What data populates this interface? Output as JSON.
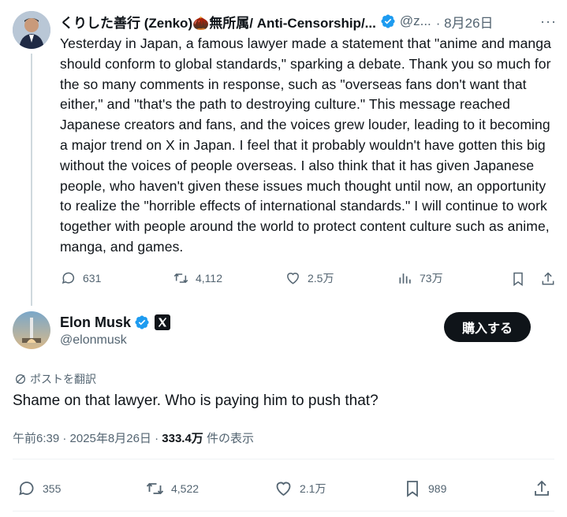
{
  "reply_tweet": {
    "author_name": "くりした善行 (Zenko)🌰無所属/ Anti-Censorship/...",
    "handle": "@z...",
    "timestamp": "· 8月26日",
    "text": "Yesterday in Japan, a famous lawyer made a statement that \"anime and manga should conform to global standards,\" sparking a debate. Thank you so much for the so many comments in response, such as \"overseas fans don't want that either,\" and \"that's the path to destroying culture.\" This message reached Japanese creators and fans, and the voices grew louder, leading to it becoming a major trend on X in Japan. I feel that it probably wouldn't have gotten this big without the voices of people overseas. I also think that it has given Japanese people, who haven't given these issues much thought until now, an opportunity to realize the \"horrible effects of international standards.\" I will continue to work together with people around the world to protect content culture such as anime, manga, and games.",
    "metrics": {
      "replies": "631",
      "reposts": "4,112",
      "likes": "2.5万",
      "views": "73万"
    }
  },
  "main_tweet": {
    "author_name": "Elon Musk",
    "handle": "@elonmusk",
    "buy_button_label": "購入する",
    "translate_label": "ポストを翻訳",
    "text": "Shame on that lawyer. Who is paying him to push that?",
    "time_date": "午前6:39 · 2025年8月26日 · ",
    "views_count": "333.4万",
    "views_label": " 件の表示",
    "metrics": {
      "replies": "355",
      "reposts": "4,522",
      "likes": "2.1万",
      "bookmarks": "989"
    }
  },
  "colors": {
    "verified_blue": "#1d9bf0",
    "muted": "#536471",
    "text": "#0f1419"
  }
}
